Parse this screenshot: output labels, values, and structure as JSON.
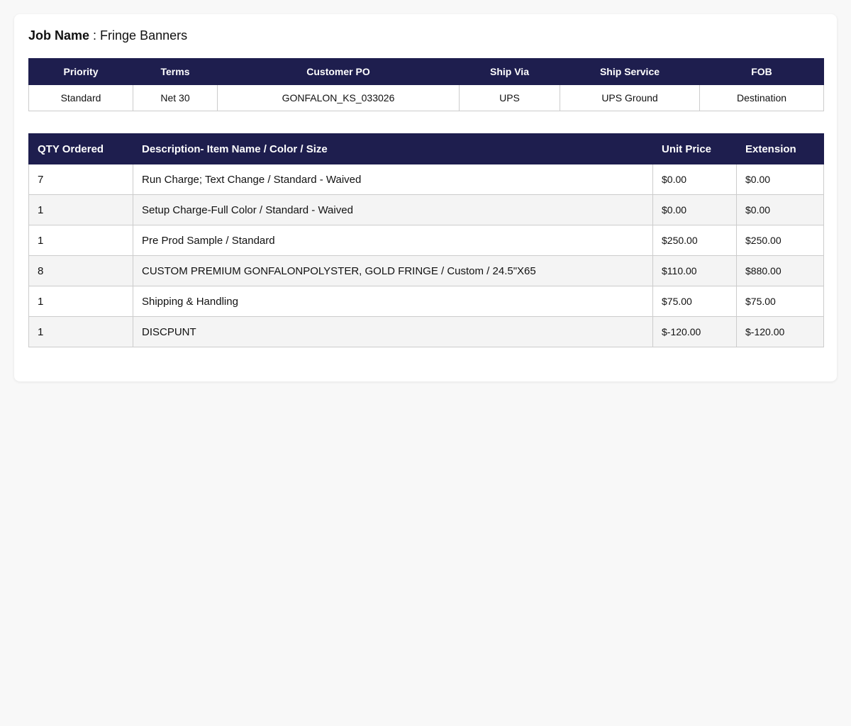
{
  "job": {
    "label": "Job Name",
    "separator": " : ",
    "value": "Fringe Banners"
  },
  "order_info": {
    "headers": [
      "Priority",
      "Terms",
      "Customer PO",
      "Ship Via",
      "Ship Service",
      "FOB"
    ],
    "values": [
      "Standard",
      "Net 30",
      "GONFALON_KS_033026",
      "UPS",
      "UPS Ground",
      "Destination"
    ]
  },
  "items": {
    "headers": [
      "QTY Ordered",
      "Description- Item Name / Color / Size",
      "Unit Price",
      "Extension"
    ],
    "rows": [
      {
        "qty": "7",
        "description": "Run Charge; Text Change / Standard - Waived",
        "unit_price": "$0.00",
        "extension": "$0.00"
      },
      {
        "qty": "1",
        "description": "Setup Charge-Full Color / Standard - Waived",
        "unit_price": "$0.00",
        "extension": "$0.00"
      },
      {
        "qty": "1",
        "description": "Pre Prod Sample / Standard",
        "unit_price": "$250.00",
        "extension": "$250.00"
      },
      {
        "qty": "8",
        "description": "CUSTOM PREMIUM GONFALONPOLYSTER, GOLD FRINGE / Custom / 24.5\"X65",
        "unit_price": "$110.00",
        "extension": "$880.00"
      },
      {
        "qty": "1",
        "description": "Shipping & Handling",
        "unit_price": "$75.00",
        "extension": "$75.00"
      },
      {
        "qty": "1",
        "description": "DISCPUNT",
        "unit_price": "$-120.00",
        "extension": "$-120.00"
      }
    ]
  },
  "colors": {
    "header_bg": "#1e1e4e",
    "header_text": "#ffffff",
    "border": "#cccccc",
    "alt_row": "#f4f4f4"
  }
}
